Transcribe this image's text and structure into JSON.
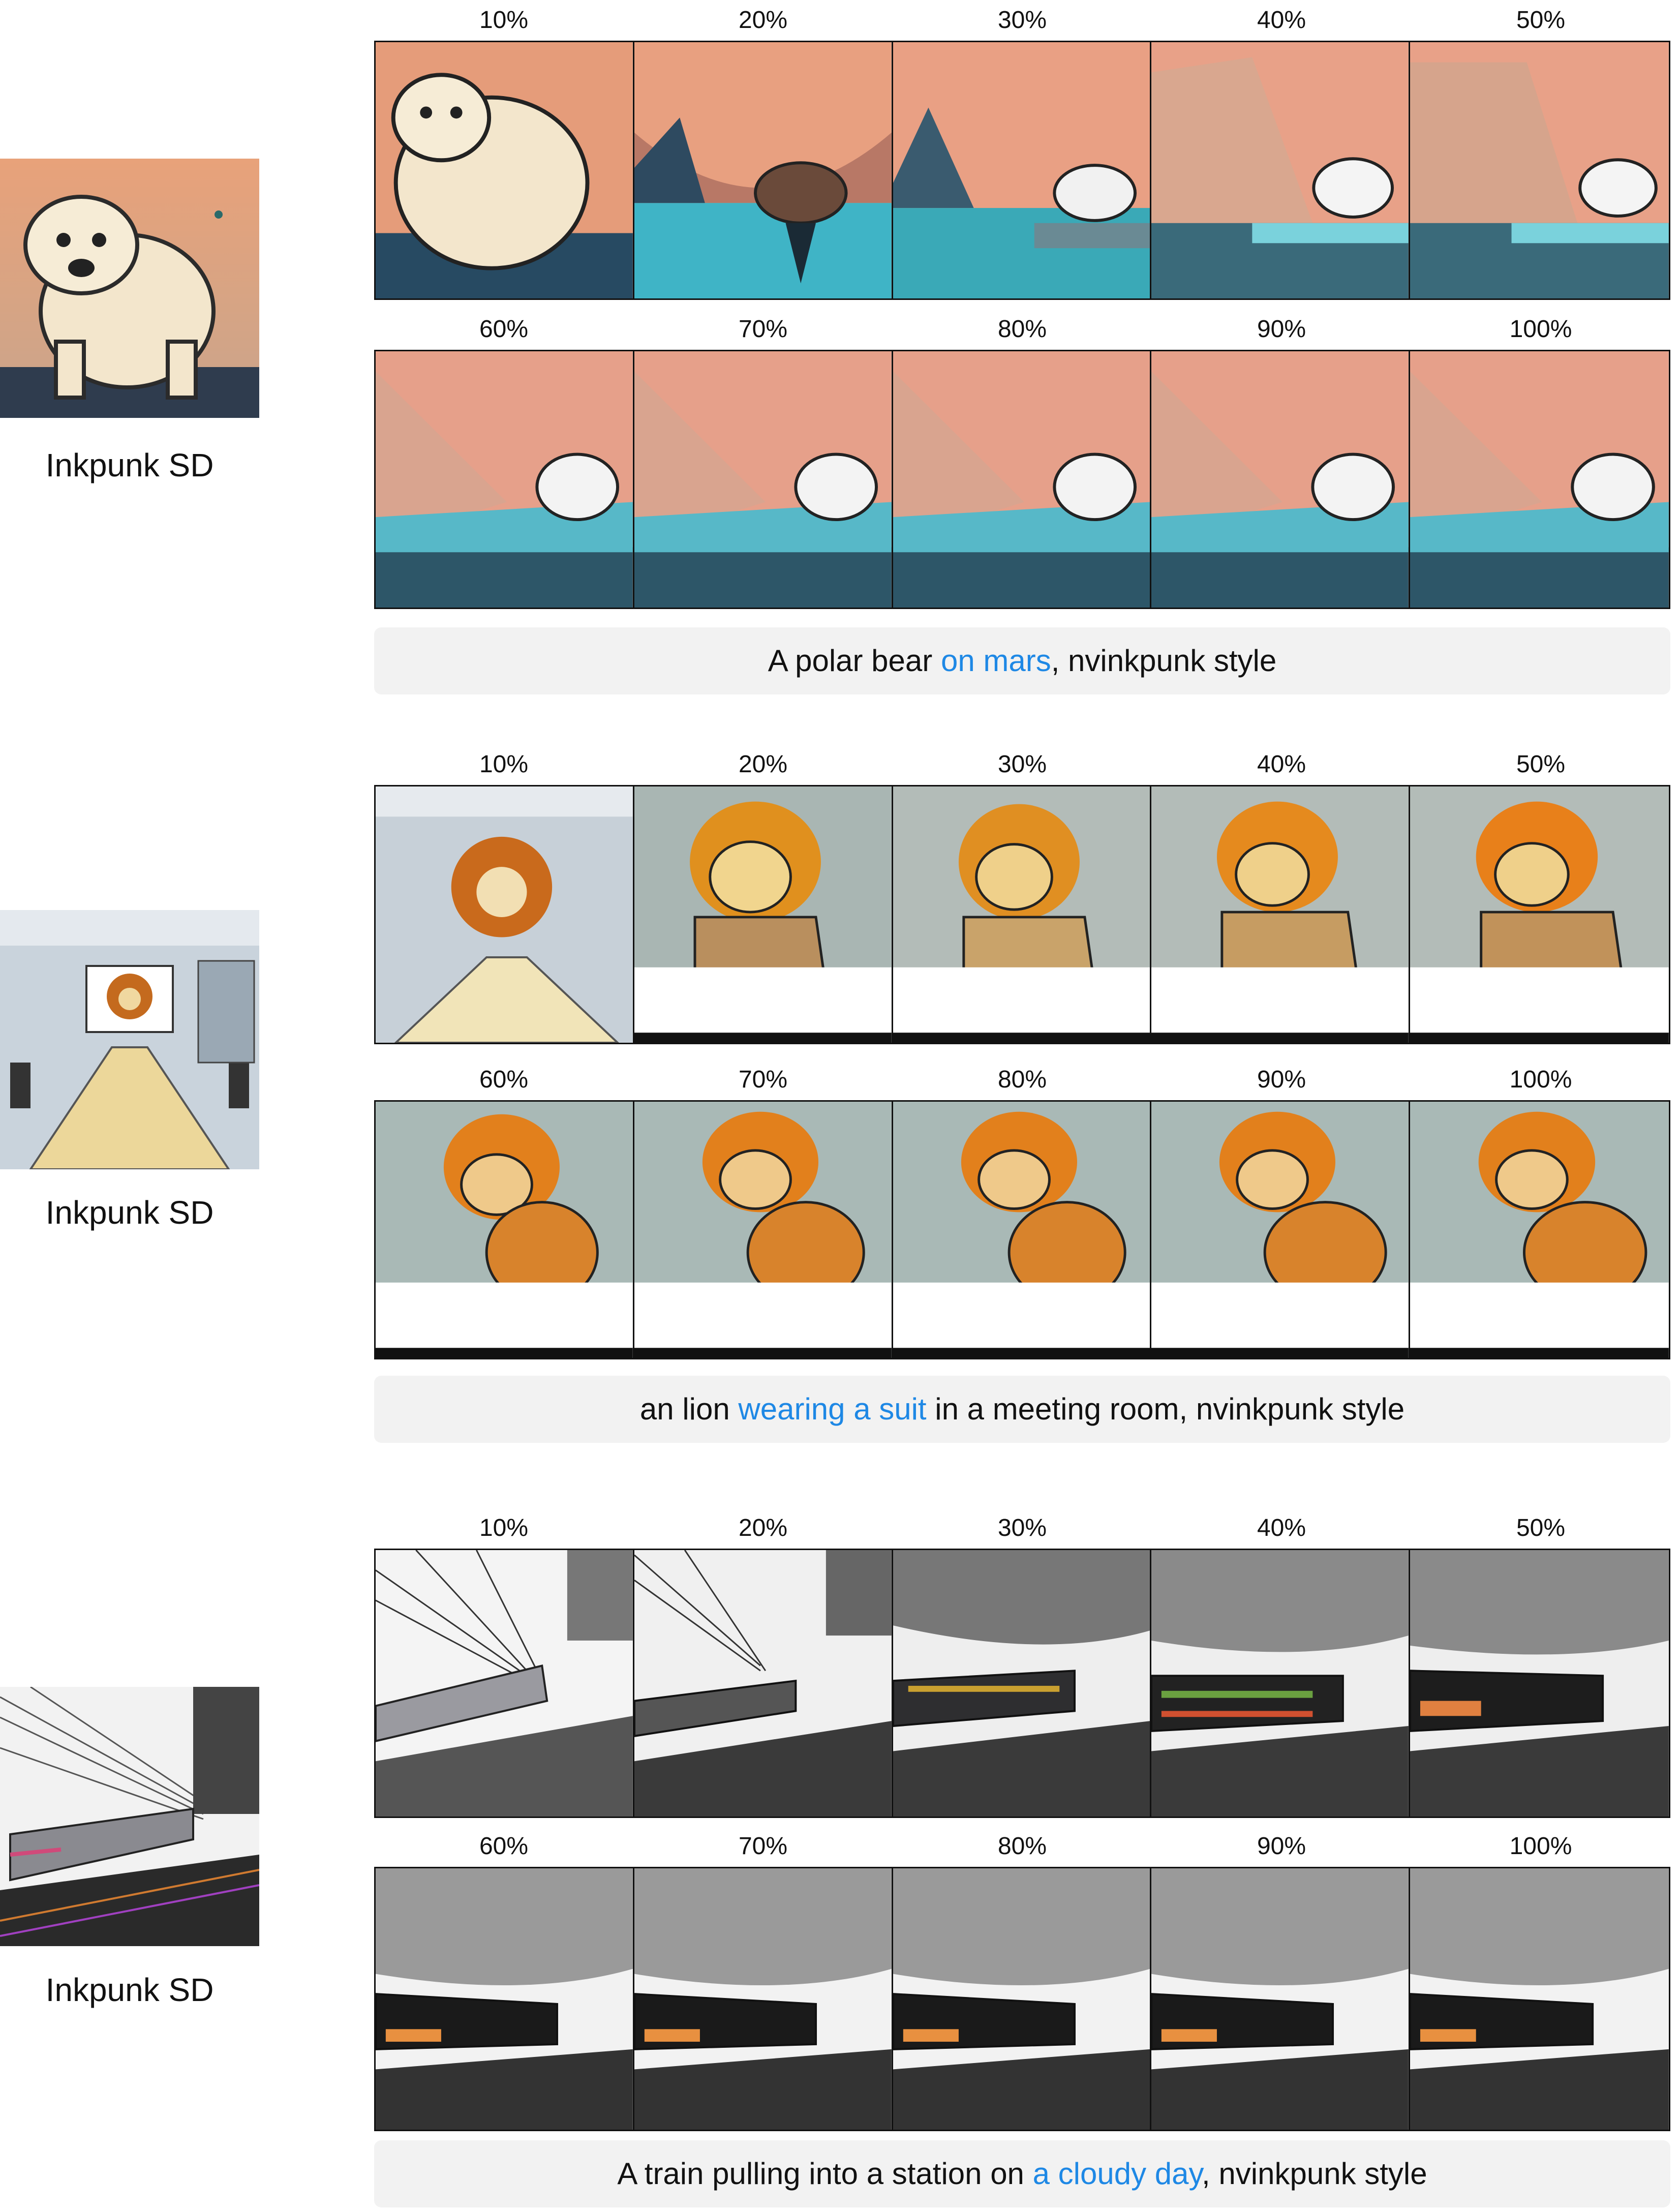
{
  "colors": {
    "highlight": "#1e88e5",
    "prompt_bg": "#f2f2f2",
    "text": "#111111"
  },
  "sections": [
    {
      "source_label": "Inkpunk SD",
      "rows": [
        [
          "10%",
          "20%",
          "30%",
          "40%",
          "50%"
        ],
        [
          "60%",
          "70%",
          "80%",
          "90%",
          "100%"
        ]
      ],
      "prompt": {
        "before": "A polar bear ",
        "highlight": "on mars",
        "after": ", nvinkpunk style"
      }
    },
    {
      "source_label": "Inkpunk SD",
      "rows": [
        [
          "10%",
          "20%",
          "30%",
          "40%",
          "50%"
        ],
        [
          "60%",
          "70%",
          "80%",
          "90%",
          "100%"
        ]
      ],
      "prompt": {
        "before": "an lion ",
        "highlight": "wearing a suit",
        "after": " in a meeting room, nvinkpunk style"
      }
    },
    {
      "source_label": "Inkpunk SD",
      "rows": [
        [
          "10%",
          "20%",
          "30%",
          "40%",
          "50%"
        ],
        [
          "60%",
          "70%",
          "80%",
          "90%",
          "100%"
        ]
      ],
      "prompt": {
        "before": "A train pulling into a station on ",
        "highlight": "a cloudy day",
        "after": ", nvinkpunk style"
      }
    }
  ]
}
